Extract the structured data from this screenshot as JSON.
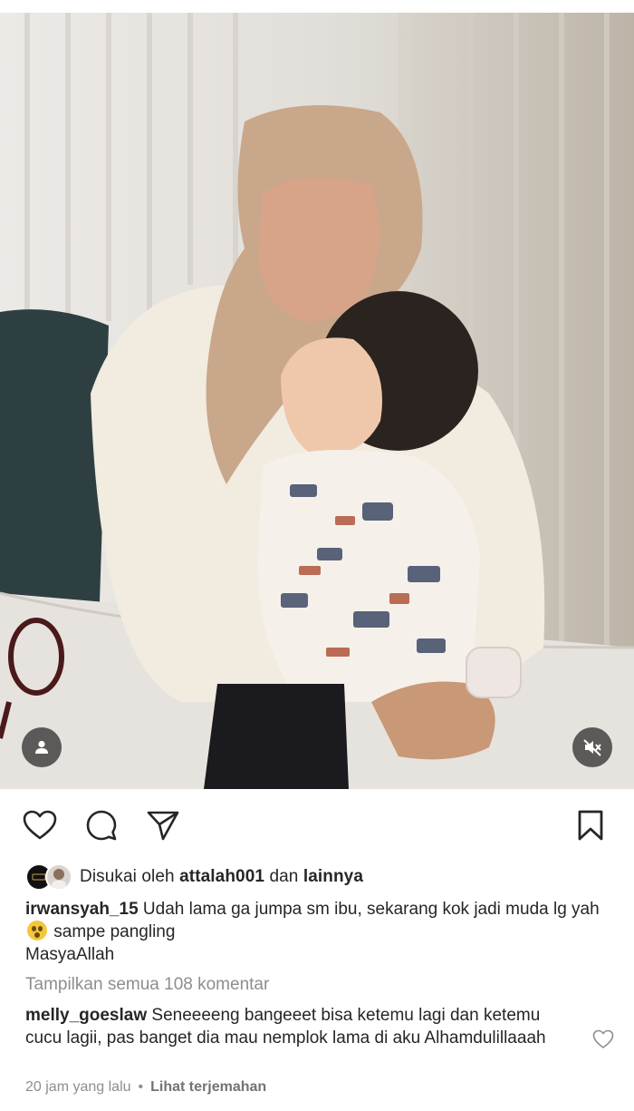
{
  "post": {
    "liked_by_prefix": "Disukai oleh",
    "liked_by_user": "attalah001",
    "liked_by_conj": "dan",
    "liked_by_others": "lainnya",
    "caption": {
      "username": "irwansyah_15",
      "text_1": "Udah lama ga jumpa sm ibu, sekarang kok jadi muda lg yah",
      "text_2": "sampe pangling",
      "line_2": "MasyaAllah"
    },
    "view_all_comments": "Tampilkan semua 108 komentar",
    "comment": {
      "username": "melly_goeslaw",
      "text": "Seneeeeng bangeeet bisa ketemu lagi dan ketemu cucu lagii, pas banget dia mau nemplok lama di aku Alhamdulillaaah"
    },
    "time_ago": "20 jam yang lalu",
    "separator": "•",
    "see_translation": "Lihat terjemahan"
  },
  "icons": {
    "like": "heart-icon",
    "comment": "comment-bubble-icon",
    "share": "paper-plane-icon",
    "save": "bookmark-icon",
    "tag": "user-tag-icon",
    "mute": "muted-speaker-icon",
    "comment_like": "small-heart-icon"
  },
  "colors": {
    "text": "#262626",
    "secondary": "#8e8e8e",
    "background": "#ffffff"
  }
}
